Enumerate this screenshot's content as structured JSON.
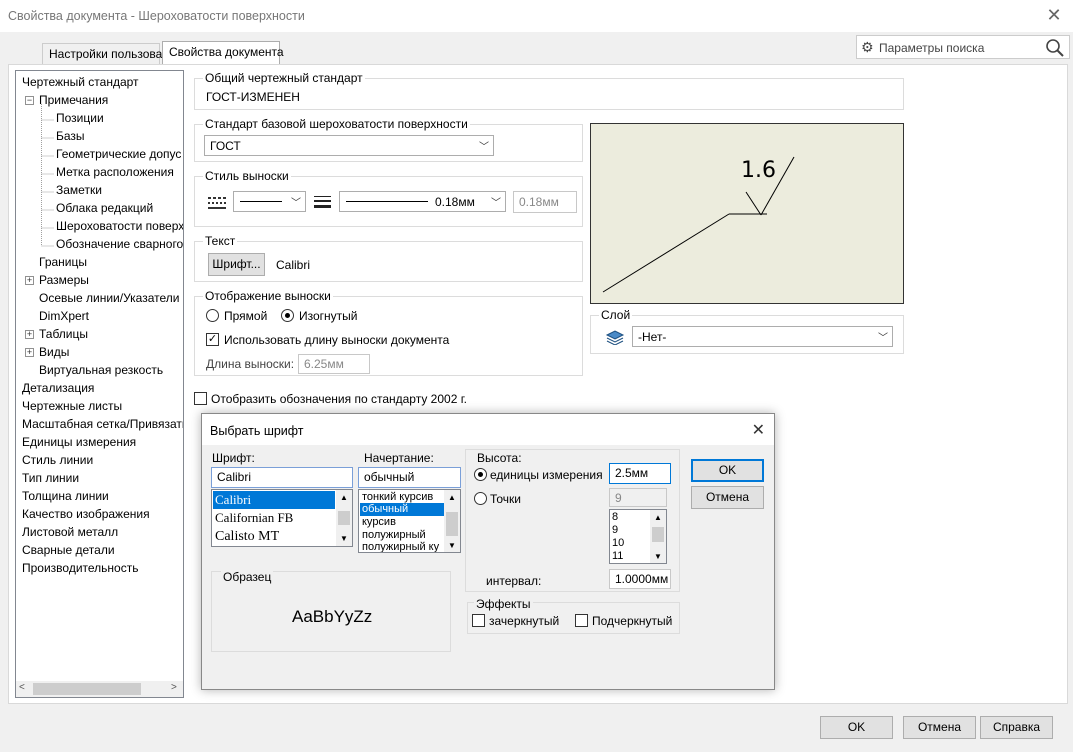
{
  "window": {
    "title": "Свойства документа - Шероховатости поверхности"
  },
  "tabs": [
    {
      "label": "Настройки пользователя"
    },
    {
      "label": "Свойства документа"
    }
  ],
  "search": {
    "placeholder": "Параметры поиска"
  },
  "tree": {
    "items": [
      {
        "label": "Чертежный стандарт"
      },
      {
        "label": "Примечания"
      },
      {
        "label": "Позиции"
      },
      {
        "label": "Базы"
      },
      {
        "label": "Геометрические допус"
      },
      {
        "label": "Метка расположения"
      },
      {
        "label": "Заметки"
      },
      {
        "label": "Облака редакций"
      },
      {
        "label": "Шероховатости поверх"
      },
      {
        "label": "Обозначение сварного"
      },
      {
        "label": "Границы"
      },
      {
        "label": "Размеры"
      },
      {
        "label": "Осевые линии/Указатели"
      },
      {
        "label": "DimXpert"
      },
      {
        "label": "Таблицы"
      },
      {
        "label": "Виды"
      },
      {
        "label": "Виртуальная резкость"
      },
      {
        "label": "Детализация"
      },
      {
        "label": "Чертежные листы"
      },
      {
        "label": "Масштабная сетка/Привязать"
      },
      {
        "label": "Единицы измерения"
      },
      {
        "label": "Стиль линии"
      },
      {
        "label": "Тип линии"
      },
      {
        "label": "Толщина линии"
      },
      {
        "label": "Качество изображения"
      },
      {
        "label": "Листовой металл"
      },
      {
        "label": "Сварные детали"
      },
      {
        "label": "Производительность"
      }
    ]
  },
  "general_standard": {
    "label": "Общий чертежный стандарт",
    "value": "ГОСТ-ИЗМЕНЕН"
  },
  "base_standard": {
    "label": "Стандарт базовой шероховатости поверхности",
    "value": "ГОСТ"
  },
  "leader_style": {
    "label": "Стиль выноски",
    "thickness": "0.18мм",
    "custom_thickness": "0.18мм"
  },
  "text": {
    "label": "Текст",
    "font_button": "Шрифт...",
    "font_name": "Calibri"
  },
  "leader_display": {
    "label": "Отображение выноски",
    "straight": "Прямой",
    "bent": "Изогнутый",
    "use_doc_length": "Использовать длину выноски документа",
    "length_label": "Длина выноски:",
    "length_value": "6.25мм"
  },
  "preview": {
    "value": "1.6"
  },
  "layer": {
    "label": "Слой",
    "value": "-Нет-"
  },
  "display_2002": {
    "label": "Отобразить обозначения по стандарту 2002 г."
  },
  "font_dialog": {
    "title": "Выбрать шрифт",
    "font_label": "Шрифт:",
    "font_value": "Calibri",
    "fonts": [
      "Calibri",
      "Californian FB",
      "Calisto MT"
    ],
    "style_label": "Начертание:",
    "style_value": "обычный",
    "styles": [
      "тонкий курсив",
      "обычный",
      "курсив",
      "полужирный",
      "полужирный ку"
    ],
    "height_label": "Высота:",
    "units_label": "единицы измерения",
    "units_value": "2.5мм",
    "points_label": "Точки",
    "points_value": "9",
    "points_list": [
      "8",
      "9",
      "10",
      "11"
    ],
    "spacing_label": "интервал:",
    "spacing_value": "1.0000мм",
    "ok": "OK",
    "cancel": "Отмена",
    "sample_label": "Образец",
    "sample_text": "AaBbYyZz",
    "effects_label": "Эффекты",
    "strike": "зачеркнутый",
    "underline": "Подчеркнутый"
  },
  "footer": {
    "ok": "OK",
    "cancel": "Отмена",
    "help": "Справка"
  }
}
